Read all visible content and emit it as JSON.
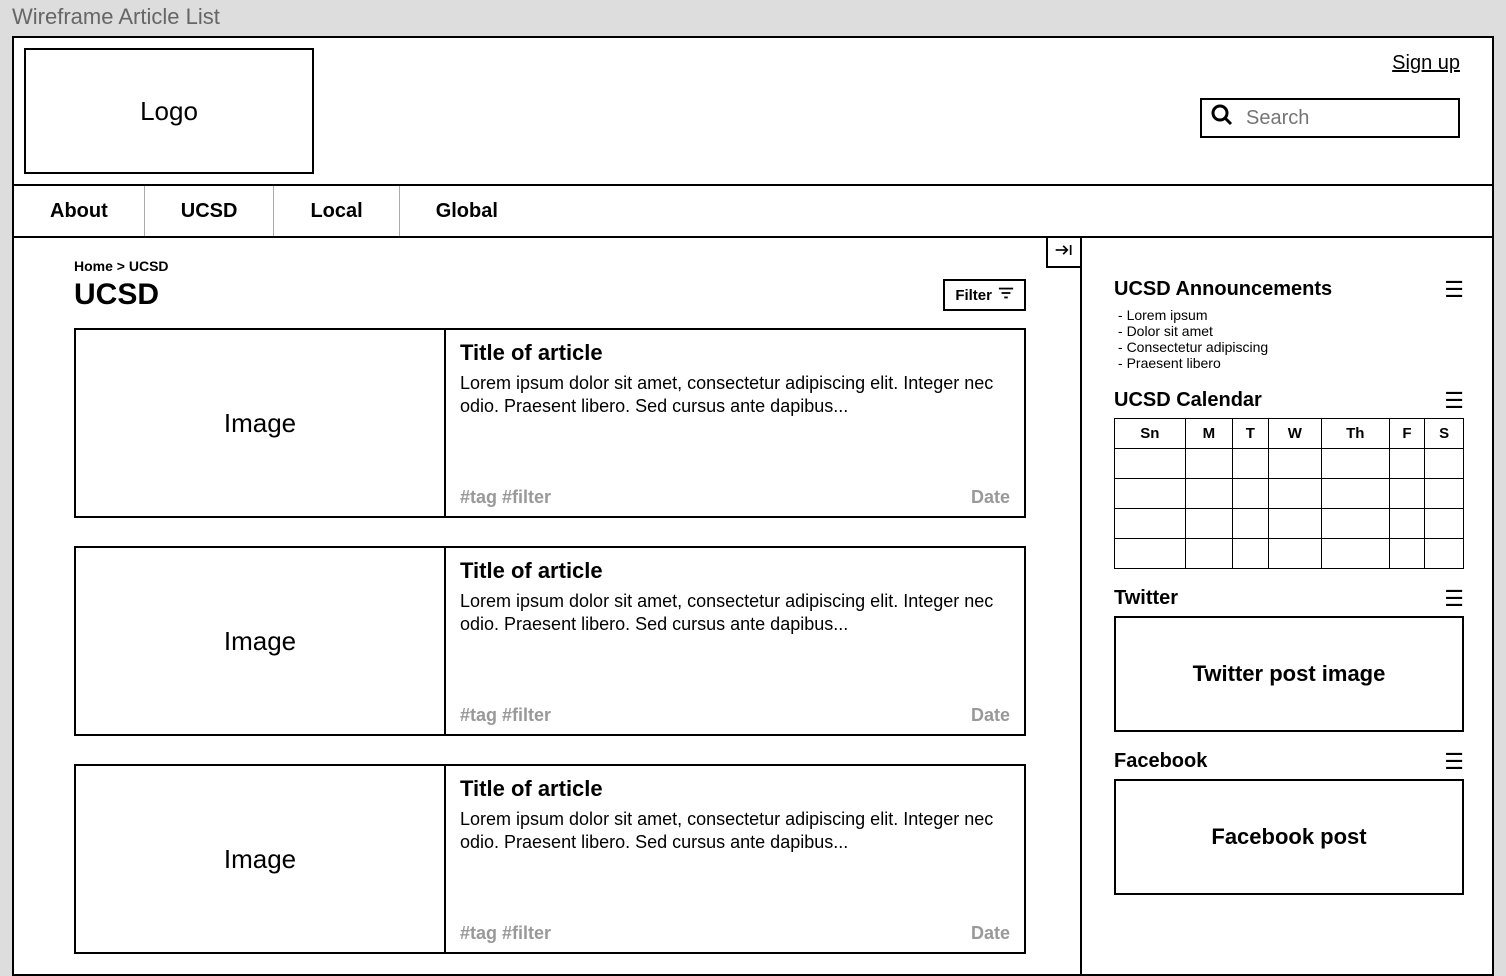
{
  "window_title": "Wireframe Article List",
  "header": {
    "logo_label": "Logo",
    "signup_label": "Sign up",
    "search_placeholder": "Search"
  },
  "nav": {
    "items": [
      {
        "label": "About"
      },
      {
        "label": "UCSD"
      },
      {
        "label": "Local"
      },
      {
        "label": "Global"
      }
    ]
  },
  "main": {
    "breadcrumb": "Home > UCSD",
    "title": "UCSD",
    "filter_label": "Filter",
    "image_placeholder": "Image",
    "articles": [
      {
        "title": "Title of article",
        "excerpt": "Lorem ipsum dolor sit amet, consectetur adipiscing elit. Integer nec odio. Praesent libero. Sed cursus ante dapibus...",
        "tags": "#tag #filter",
        "date": "Date"
      },
      {
        "title": "Title of article",
        "excerpt": "Lorem ipsum dolor sit amet, consectetur adipiscing elit. Integer nec odio. Praesent libero. Sed cursus ante dapibus...",
        "tags": "#tag #filter",
        "date": "Date"
      },
      {
        "title": "Title of article",
        "excerpt": "Lorem ipsum dolor sit amet, consectetur adipiscing elit. Integer nec odio. Praesent libero. Sed cursus ante dapibus...",
        "tags": "#tag #filter",
        "date": "Date"
      }
    ]
  },
  "sidebar": {
    "announcements": {
      "title": "UCSD Announcements",
      "items": [
        "Lorem ipsum",
        "Dolor sit amet",
        "Consectetur adipiscing",
        "Praesent libero"
      ]
    },
    "calendar": {
      "title": "UCSD Calendar",
      "days": [
        "Sn",
        "M",
        "T",
        "W",
        "Th",
        "F",
        "S"
      ]
    },
    "twitter": {
      "title": "Twitter",
      "box_label": "Twitter post image"
    },
    "facebook": {
      "title": "Facebook",
      "box_label": "Facebook post"
    }
  }
}
